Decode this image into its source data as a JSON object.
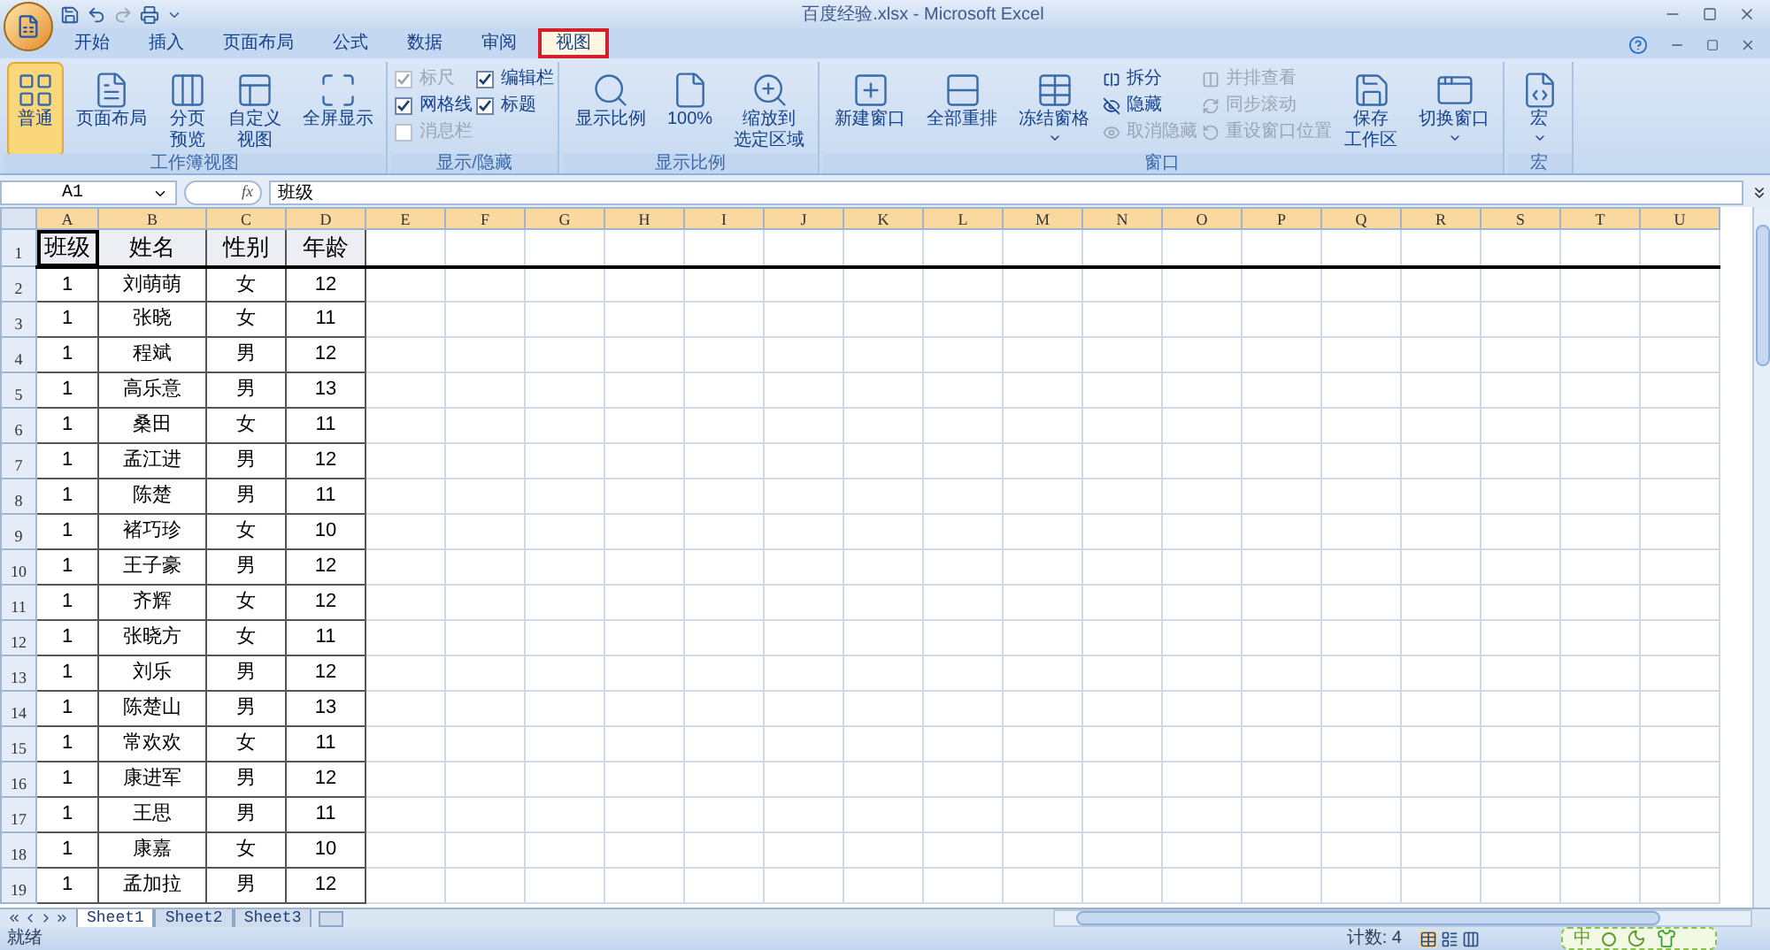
{
  "window": {
    "title": "百度经验.xlsx - Microsoft Excel"
  },
  "ribbon_tabs": [
    {
      "label": "开始",
      "selected": false,
      "outlined": false
    },
    {
      "label": "插入",
      "selected": false,
      "outlined": false
    },
    {
      "label": "页面布局",
      "selected": false,
      "outlined": false
    },
    {
      "label": "公式",
      "selected": false,
      "outlined": false
    },
    {
      "label": "数据",
      "selected": false,
      "outlined": false
    },
    {
      "label": "审阅",
      "selected": false,
      "outlined": false
    },
    {
      "label": "视图",
      "selected": true,
      "outlined": true
    }
  ],
  "ribbon_groups": [
    {
      "label": "工作簿视图",
      "controls": [
        {
          "kind": "large",
          "lines": [
            "普通"
          ],
          "selected": true,
          "caret": false
        },
        {
          "kind": "large",
          "lines": [
            "页面布局"
          ],
          "selected": false,
          "caret": false
        },
        {
          "kind": "large",
          "lines": [
            "分页",
            "预览"
          ],
          "selected": false,
          "caret": false
        },
        {
          "kind": "large",
          "lines": [
            "自定义",
            "视图"
          ],
          "selected": false,
          "caret": false
        },
        {
          "kind": "large",
          "lines": [
            "全屏显示"
          ],
          "selected": false,
          "caret": false
        }
      ]
    },
    {
      "label": "显示/隐藏",
      "controls": [
        {
          "kind": "checks",
          "items": [
            {
              "label": "标尺",
              "checked": true,
              "disabled": true
            },
            {
              "label": "网格线",
              "checked": true,
              "disabled": false
            },
            {
              "label": "消息栏",
              "checked": false,
              "disabled": true
            }
          ]
        },
        {
          "kind": "checks",
          "items": [
            {
              "label": "编辑栏",
              "checked": true,
              "disabled": false
            },
            {
              "label": "标题",
              "checked": true,
              "disabled": false
            }
          ]
        }
      ]
    },
    {
      "label": "显示比例",
      "controls": [
        {
          "kind": "large",
          "lines": [
            "显示比例"
          ],
          "selected": false,
          "caret": false
        },
        {
          "kind": "large",
          "lines": [
            "100%"
          ],
          "selected": false,
          "caret": false
        },
        {
          "kind": "large",
          "lines": [
            "缩放到",
            "选定区域"
          ],
          "selected": false,
          "caret": false
        }
      ]
    },
    {
      "label": "窗口",
      "controls": [
        {
          "kind": "large",
          "lines": [
            "新建窗口"
          ],
          "selected": false,
          "caret": false
        },
        {
          "kind": "large",
          "lines": [
            "全部重排"
          ],
          "selected": false,
          "caret": false
        },
        {
          "kind": "large",
          "lines": [
            "冻结窗格"
          ],
          "selected": false,
          "caret": true
        },
        {
          "kind": "smalls",
          "items": [
            {
              "label": "拆分",
              "disabled": false
            },
            {
              "label": "隐藏",
              "disabled": false
            },
            {
              "label": "取消隐藏",
              "disabled": true
            }
          ]
        },
        {
          "kind": "smalls",
          "items": [
            {
              "label": "并排查看",
              "disabled": true
            },
            {
              "label": "同步滚动",
              "disabled": true
            },
            {
              "label": "重设窗口位置",
              "disabled": true
            }
          ]
        },
        {
          "kind": "large",
          "lines": [
            "保存",
            "工作区"
          ],
          "selected": false,
          "caret": false
        },
        {
          "kind": "large",
          "lines": [
            "切换窗口"
          ],
          "selected": false,
          "caret": true
        }
      ]
    },
    {
      "label": "宏",
      "controls": [
        {
          "kind": "large",
          "lines": [
            "宏"
          ],
          "selected": false,
          "caret": true
        }
      ]
    }
  ],
  "formula_bar": {
    "name_box": "A1",
    "function_label": "fx",
    "formula": "班级"
  },
  "sheet": {
    "columns": [
      "A",
      "B",
      "C",
      "D",
      "E",
      "F",
      "G",
      "H",
      "I",
      "J",
      "K",
      "L",
      "M",
      "N",
      "O",
      "P",
      "Q",
      "R",
      "S",
      "T",
      "U"
    ],
    "rows": [
      {
        "number": "1",
        "cells": [
          "班级",
          "姓名",
          "性别",
          "年龄"
        ]
      },
      {
        "number": "2",
        "cells": [
          "1",
          "刘萌萌",
          "女",
          "12"
        ]
      },
      {
        "number": "3",
        "cells": [
          "1",
          "张晓",
          "女",
          "11"
        ]
      },
      {
        "number": "4",
        "cells": [
          "1",
          "程斌",
          "男",
          "12"
        ]
      },
      {
        "number": "5",
        "cells": [
          "1",
          "高乐意",
          "男",
          "13"
        ]
      },
      {
        "number": "6",
        "cells": [
          "1",
          "桑田",
          "女",
          "11"
        ]
      },
      {
        "number": "7",
        "cells": [
          "1",
          "孟江进",
          "男",
          "12"
        ]
      },
      {
        "number": "8",
        "cells": [
          "1",
          "陈楚",
          "男",
          "11"
        ]
      },
      {
        "number": "9",
        "cells": [
          "1",
          "褚巧珍",
          "女",
          "10"
        ]
      },
      {
        "number": "10",
        "cells": [
          "1",
          "王子豪",
          "男",
          "12"
        ]
      },
      {
        "number": "11",
        "cells": [
          "1",
          "齐辉",
          "女",
          "12"
        ]
      },
      {
        "number": "12",
        "cells": [
          "1",
          "张晓方",
          "女",
          "11"
        ]
      },
      {
        "number": "13",
        "cells": [
          "1",
          "刘乐",
          "男",
          "12"
        ]
      },
      {
        "number": "14",
        "cells": [
          "1",
          "陈楚山",
          "男",
          "13"
        ]
      },
      {
        "number": "15",
        "cells": [
          "1",
          "常欢欢",
          "女",
          "11"
        ]
      },
      {
        "number": "16",
        "cells": [
          "1",
          "康进军",
          "男",
          "12"
        ]
      },
      {
        "number": "17",
        "cells": [
          "1",
          "王思",
          "男",
          "11"
        ]
      },
      {
        "number": "18",
        "cells": [
          "1",
          "康嘉",
          "女",
          "10"
        ]
      },
      {
        "number": "19",
        "cells": [
          "1",
          "孟加拉",
          "男",
          "12"
        ]
      }
    ]
  },
  "sheet_tabs": [
    {
      "label": "Sheet1",
      "selected": true
    },
    {
      "label": "Sheet2",
      "selected": false
    },
    {
      "label": "Sheet3",
      "selected": false
    }
  ],
  "status_bar": {
    "mode": "就绪",
    "count": "计数: 4"
  },
  "ime_bar": {
    "label": "中"
  }
}
